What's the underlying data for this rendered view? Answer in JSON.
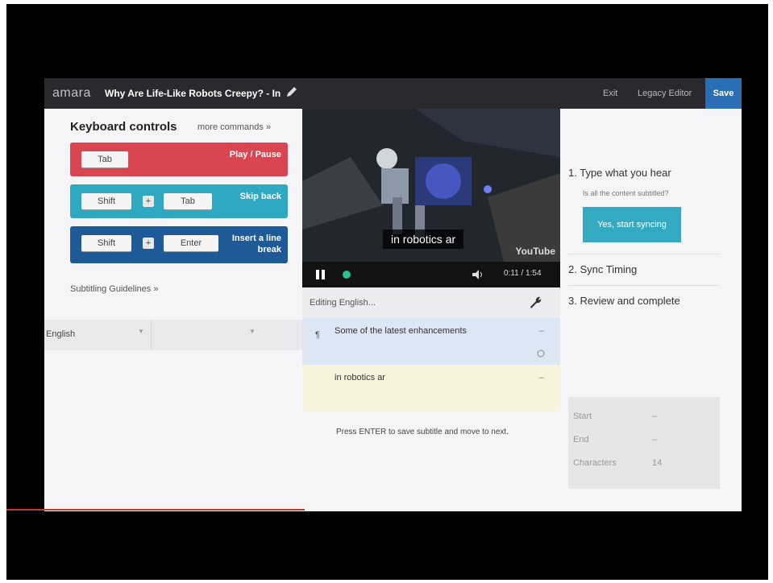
{
  "header": {
    "brand": "amara",
    "video_title": "Why Are Life-Like Robots Creepy? - In",
    "exit_label": "Exit",
    "legacy_label": "Legacy Editor",
    "save_label": "Save"
  },
  "keyboard": {
    "title": "Keyboard controls",
    "more_commands": "more commands »",
    "row1": {
      "key": "Tab",
      "action": "Play / Pause"
    },
    "row2": {
      "key1": "Shift",
      "plus": "+",
      "key2": "Tab",
      "action": "Skip back"
    },
    "row3": {
      "key1": "Shift",
      "plus": "+",
      "key2": "Enter",
      "action_line1": "Insert a line",
      "action_line2": "break"
    },
    "guidelines": "Subtitling Guidelines »"
  },
  "language": {
    "selected": "English"
  },
  "video": {
    "subtitle_overlay": "in robotics ar",
    "youtube_logo": "YouTube",
    "time": "0:11 / 1:54"
  },
  "editor": {
    "title": "Editing English...",
    "subtitle1": "Some of the latest enhancements",
    "subtitle2": "in robotics ar",
    "dash": "–",
    "hint": "Press ENTER to save subtitle and move to next."
  },
  "steps": {
    "step1": "1. Type what you hear",
    "step1_question": "Is all the content subtitled?",
    "sync_button": "Yes, start syncing",
    "step2": "2. Sync Timing",
    "step3": "3. Review and complete"
  },
  "info": {
    "start_label": "Start",
    "start_value": "–",
    "end_label": "End",
    "end_value": "–",
    "chars_label": "Characters",
    "chars_value": "14"
  },
  "colors": {
    "play_pause": "#d94550",
    "skip_back": "#2fa9c1",
    "line_break": "#1f5a98",
    "save": "#2a6fb5"
  }
}
